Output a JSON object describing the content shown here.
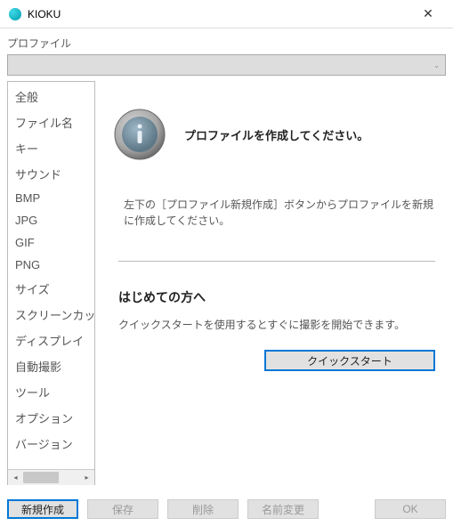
{
  "window": {
    "title": "KIOKU"
  },
  "profile": {
    "label": "プロファイル",
    "selected": ""
  },
  "sidebar": {
    "items": [
      {
        "label": "全般"
      },
      {
        "label": "ファイル名"
      },
      {
        "label": "キー"
      },
      {
        "label": "サウンド"
      },
      {
        "label": "BMP"
      },
      {
        "label": "JPG"
      },
      {
        "label": "GIF"
      },
      {
        "label": "PNG"
      },
      {
        "label": "サイズ"
      },
      {
        "label": "スクリーンカット"
      },
      {
        "label": "ディスプレイ"
      },
      {
        "label": "自動撮影"
      },
      {
        "label": "ツール"
      },
      {
        "label": "オプション"
      },
      {
        "label": "バージョン"
      }
    ]
  },
  "main": {
    "heading": "プロファイルを作成してください。",
    "instruction": "左下の［プロファイル新規作成］ボタンからプロファイルを新規に作成してください。",
    "first_time_heading": "はじめての方へ",
    "first_time_text": "クイックスタートを使用するとすぐに撮影を開始できます。",
    "quickstart_label": "クイックスタート"
  },
  "buttons": {
    "new": "新規作成",
    "save": "保存",
    "delete": "削除",
    "rename": "名前変更",
    "ok": "OK"
  }
}
